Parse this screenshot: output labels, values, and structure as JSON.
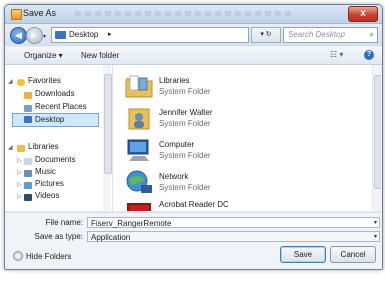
{
  "window": {
    "title": "Save As",
    "close_label": "x"
  },
  "addressbar": {
    "back_icon": "◀",
    "forward_icon": "▶",
    "path": "Desktop",
    "path_arrow": "▸",
    "refresh": "▾ ↻",
    "search_placeholder": "Search Desktop",
    "search_icon": "⌕"
  },
  "toolbar": {
    "organize": "Organize ▾",
    "new_folder": "New folder",
    "views": "☷ ▾",
    "help": "?"
  },
  "nav": {
    "items": [
      {
        "label": "Favorites",
        "icon": "star-icon"
      },
      {
        "label": "Downloads",
        "icon": "downloads-folder-icon"
      },
      {
        "label": "Recent Places",
        "icon": "recent-places-icon"
      },
      {
        "label": "Desktop",
        "icon": "desktop-icon"
      },
      {
        "label": "Libraries",
        "icon": "libraries-icon"
      },
      {
        "label": "Documents",
        "icon": "documents-icon"
      },
      {
        "label": "Music",
        "icon": "music-icon"
      },
      {
        "label": "Pictures",
        "icon": "pictures-icon"
      },
      {
        "label": "Videos",
        "icon": "videos-icon"
      }
    ]
  },
  "files": [
    {
      "name": "Libraries",
      "type": "System Folder",
      "icon": "libraries-folder-icon"
    },
    {
      "name": "Jennifer Walter",
      "type": "System Folder",
      "icon": "user-folder-icon"
    },
    {
      "name": "Computer",
      "type": "System Folder",
      "icon": "computer-icon"
    },
    {
      "name": "Network",
      "type": "System Folder",
      "icon": "network-icon"
    },
    {
      "name": "Acrobat Reader DC",
      "type": "",
      "icon": "acrobat-icon"
    }
  ],
  "save": {
    "file_name_label": "File name:",
    "file_name_value": "Fiserv_RangerRemote",
    "save_type_label": "Save as type:",
    "save_type_value": "Application",
    "hide_folders": "Hide Folders",
    "save_button": "Save",
    "cancel_button": "Cancel"
  },
  "colors": {
    "accent": "#3b73c3",
    "selection": "#cde8ff",
    "close_button": "#c8452f"
  }
}
